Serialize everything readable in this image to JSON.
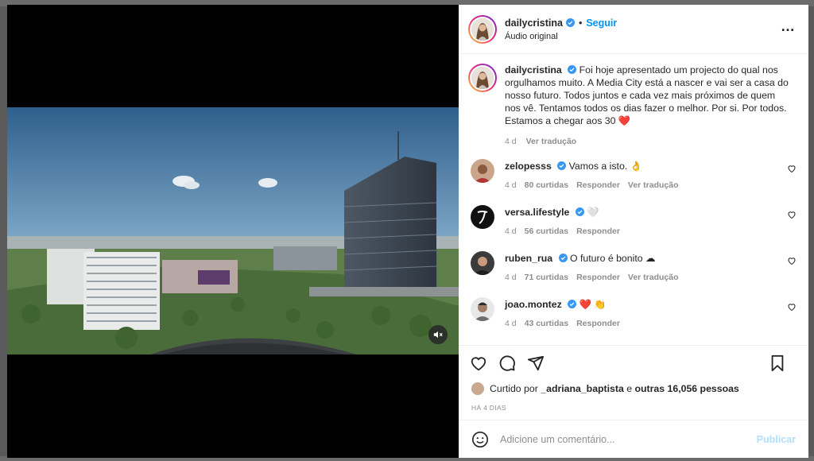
{
  "post": {
    "author": "dailycristina",
    "follow_label": "Seguir",
    "audio": "Áudio original",
    "caption": "Foi hoje apresentado um projecto do qual nos orgulhamos muito. A Media City está a nascer e vai ser a casa do nosso futuro. Todos juntos e cada vez mais próximos de quem nos vê. Tentamos todos os dias fazer o melhor. Por si. Por todos. Estamos a chegar aos 30",
    "caption_emoji": "❤️",
    "caption_age": "4 d",
    "see_translation": "Ver tradução"
  },
  "comments": [
    {
      "user": "zelopesss",
      "text": "Vamos a isto. 👌",
      "age": "4 d",
      "likes": "80 curtidas",
      "reply": "Responder",
      "translate": "Ver tradução"
    },
    {
      "user": "versa.lifestyle",
      "text": "🤍",
      "age": "4 d",
      "likes": "56 curtidas",
      "reply": "Responder"
    },
    {
      "user": "ruben_rua",
      "text": "O futuro é bonito ☁",
      "age": "4 d",
      "likes": "71 curtidas",
      "reply": "Responder",
      "translate": "Ver tradução"
    },
    {
      "user": "joao.montez",
      "text": "❤️ 👏",
      "age": "4 d",
      "likes": "43 curtidas",
      "reply": "Responder"
    }
  ],
  "likes_line": {
    "prefix": "Curtido por",
    "user": "_adriana_baptista",
    "connector": "e",
    "others": "outras 16,056 pessoas"
  },
  "posted_ago": "HÁ 4 DIAS",
  "comment_box": {
    "placeholder": "Adicione um comentário...",
    "publish_label": "Publicar"
  },
  "colors": {
    "accent": "#0095f6",
    "muted": "#8e8e8e",
    "verified": "#3897f0",
    "heart": "#ed4956"
  }
}
